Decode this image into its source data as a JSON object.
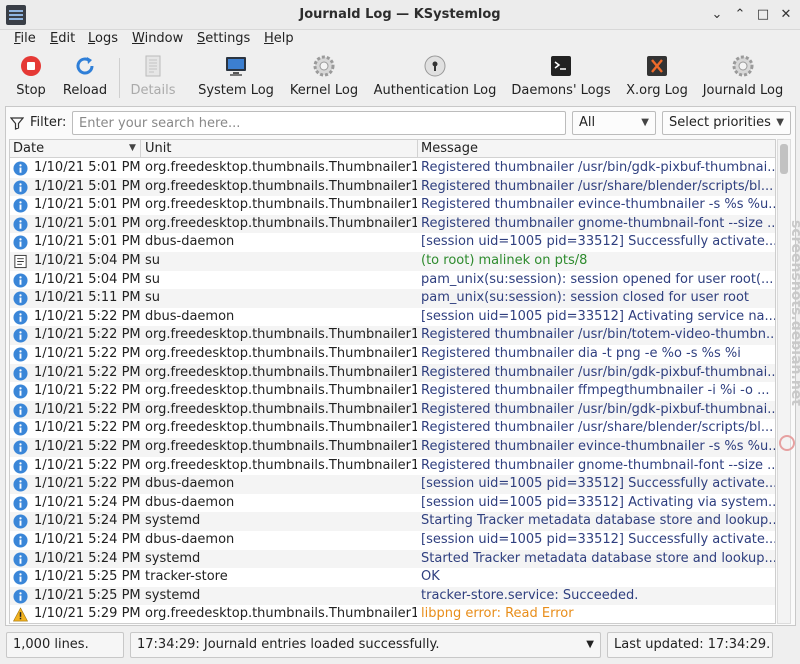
{
  "window": {
    "title": "Journald Log — KSystemlog",
    "controls": [
      "⌄",
      "⌃",
      "□",
      "✕"
    ]
  },
  "menu": [
    "File",
    "Edit",
    "Logs",
    "Window",
    "Settings",
    "Help"
  ],
  "toolbar": {
    "stop": "Stop",
    "reload": "Reload",
    "details": "Details",
    "system_log": "System Log",
    "kernel_log": "Kernel Log",
    "auth_log": "Authentication Log",
    "daemons_logs": "Daemons' Logs",
    "xorg_log": "X.org Log",
    "journald_log": "Journald Log"
  },
  "filter": {
    "label": "Filter:",
    "placeholder": "Enter your search here...",
    "scope": "All",
    "priorities": "Select priorities"
  },
  "table": {
    "headers": {
      "date": "Date",
      "unit": "Unit",
      "message": "Message"
    },
    "rows": [
      {
        "date": "1/10/21 5:01 PM",
        "unit": "org.freedesktop.thumbnails.Thumbnailer1",
        "msg": "Registered thumbnailer /usr/bin/gdk-pixbuf-thumbnai...",
        "level": "info"
      },
      {
        "date": "1/10/21 5:01 PM",
        "unit": "org.freedesktop.thumbnails.Thumbnailer1",
        "msg": "Registered thumbnailer /usr/share/blender/scripts/bl...",
        "level": "info"
      },
      {
        "date": "1/10/21 5:01 PM",
        "unit": "org.freedesktop.thumbnails.Thumbnailer1",
        "msg": "Registered thumbnailer evince-thumbnailer -s %s %u...",
        "level": "info"
      },
      {
        "date": "1/10/21 5:01 PM",
        "unit": "org.freedesktop.thumbnails.Thumbnailer1",
        "msg": "Registered thumbnailer gnome-thumbnail-font --size ...",
        "level": "info"
      },
      {
        "date": "1/10/21 5:01 PM",
        "unit": "dbus-daemon",
        "msg": "[session uid=1005 pid=33512] Successfully activate...",
        "level": "info"
      },
      {
        "date": "1/10/21 5:04 PM",
        "unit": "su",
        "msg": "(to root) malinek on pts/8",
        "level": "notice"
      },
      {
        "date": "1/10/21 5:04 PM",
        "unit": "su",
        "msg": "pam_unix(su:session): session opened for user root(...",
        "level": "info"
      },
      {
        "date": "1/10/21 5:11 PM",
        "unit": "su",
        "msg": "pam_unix(su:session): session closed for user root",
        "level": "info"
      },
      {
        "date": "1/10/21 5:22 PM",
        "unit": "dbus-daemon",
        "msg": "[session uid=1005 pid=33512] Activating service na...",
        "level": "info"
      },
      {
        "date": "1/10/21 5:22 PM",
        "unit": "org.freedesktop.thumbnails.Thumbnailer1",
        "msg": "Registered thumbnailer /usr/bin/totem-video-thumbn...",
        "level": "info"
      },
      {
        "date": "1/10/21 5:22 PM",
        "unit": "org.freedesktop.thumbnails.Thumbnailer1",
        "msg": "Registered thumbnailer dia -t png -e %o -s %s %i",
        "level": "info"
      },
      {
        "date": "1/10/21 5:22 PM",
        "unit": "org.freedesktop.thumbnails.Thumbnailer1",
        "msg": "Registered thumbnailer /usr/bin/gdk-pixbuf-thumbnai...",
        "level": "info"
      },
      {
        "date": "1/10/21 5:22 PM",
        "unit": "org.freedesktop.thumbnails.Thumbnailer1",
        "msg": "Registered thumbnailer ffmpegthumbnailer -i %i -o ...",
        "level": "info"
      },
      {
        "date": "1/10/21 5:22 PM",
        "unit": "org.freedesktop.thumbnails.Thumbnailer1",
        "msg": "Registered thumbnailer /usr/bin/gdk-pixbuf-thumbnai...",
        "level": "info"
      },
      {
        "date": "1/10/21 5:22 PM",
        "unit": "org.freedesktop.thumbnails.Thumbnailer1",
        "msg": "Registered thumbnailer /usr/share/blender/scripts/bl...",
        "level": "info"
      },
      {
        "date": "1/10/21 5:22 PM",
        "unit": "org.freedesktop.thumbnails.Thumbnailer1",
        "msg": "Registered thumbnailer evince-thumbnailer -s %s %u...",
        "level": "info"
      },
      {
        "date": "1/10/21 5:22 PM",
        "unit": "org.freedesktop.thumbnails.Thumbnailer1",
        "msg": "Registered thumbnailer gnome-thumbnail-font --size ...",
        "level": "info"
      },
      {
        "date": "1/10/21 5:22 PM",
        "unit": "dbus-daemon",
        "msg": "[session uid=1005 pid=33512] Successfully activate...",
        "level": "info"
      },
      {
        "date": "1/10/21 5:24 PM",
        "unit": "dbus-daemon",
        "msg": "[session uid=1005 pid=33512] Activating via system...",
        "level": "info"
      },
      {
        "date": "1/10/21 5:24 PM",
        "unit": "systemd",
        "msg": "Starting Tracker metadata database store and lookup...",
        "level": "info"
      },
      {
        "date": "1/10/21 5:24 PM",
        "unit": "dbus-daemon",
        "msg": "[session uid=1005 pid=33512] Successfully activate...",
        "level": "info"
      },
      {
        "date": "1/10/21 5:24 PM",
        "unit": "systemd",
        "msg": "Started Tracker metadata database store and lookup...",
        "level": "info"
      },
      {
        "date": "1/10/21 5:25 PM",
        "unit": "tracker-store",
        "msg": "OK",
        "level": "info"
      },
      {
        "date": "1/10/21 5:25 PM",
        "unit": "systemd",
        "msg": "tracker-store.service: Succeeded.",
        "level": "info"
      },
      {
        "date": "1/10/21 5:29 PM",
        "unit": "org.freedesktop.thumbnails.Thumbnailer1",
        "msg": "libpng error: Read Error",
        "level": "warning"
      }
    ]
  },
  "status": {
    "lines": "1,000 lines.",
    "message": "17:34:29: Journald entries loaded successfully.",
    "updated": "Last updated: 17:34:29."
  },
  "watermark": "screenshots.debian.net",
  "colors": {
    "info": "#3a86d8",
    "notice": "#2e8b2e",
    "warning": "#e88d1a",
    "stop": "#e53935",
    "reload": "#2f7fd8"
  }
}
